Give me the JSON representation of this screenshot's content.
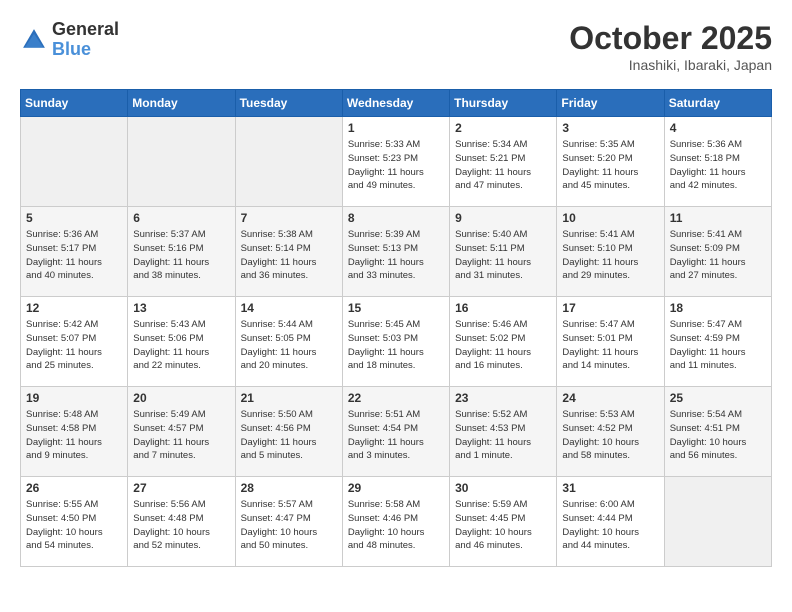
{
  "logo": {
    "line1": "General",
    "line2": "Blue"
  },
  "header": {
    "month": "October 2025",
    "location": "Inashiki, Ibaraki, Japan"
  },
  "weekdays": [
    "Sunday",
    "Monday",
    "Tuesday",
    "Wednesday",
    "Thursday",
    "Friday",
    "Saturday"
  ],
  "weeks": [
    [
      {
        "day": "",
        "info": ""
      },
      {
        "day": "",
        "info": ""
      },
      {
        "day": "",
        "info": ""
      },
      {
        "day": "1",
        "info": "Sunrise: 5:33 AM\nSunset: 5:23 PM\nDaylight: 11 hours\nand 49 minutes."
      },
      {
        "day": "2",
        "info": "Sunrise: 5:34 AM\nSunset: 5:21 PM\nDaylight: 11 hours\nand 47 minutes."
      },
      {
        "day": "3",
        "info": "Sunrise: 5:35 AM\nSunset: 5:20 PM\nDaylight: 11 hours\nand 45 minutes."
      },
      {
        "day": "4",
        "info": "Sunrise: 5:36 AM\nSunset: 5:18 PM\nDaylight: 11 hours\nand 42 minutes."
      }
    ],
    [
      {
        "day": "5",
        "info": "Sunrise: 5:36 AM\nSunset: 5:17 PM\nDaylight: 11 hours\nand 40 minutes."
      },
      {
        "day": "6",
        "info": "Sunrise: 5:37 AM\nSunset: 5:16 PM\nDaylight: 11 hours\nand 38 minutes."
      },
      {
        "day": "7",
        "info": "Sunrise: 5:38 AM\nSunset: 5:14 PM\nDaylight: 11 hours\nand 36 minutes."
      },
      {
        "day": "8",
        "info": "Sunrise: 5:39 AM\nSunset: 5:13 PM\nDaylight: 11 hours\nand 33 minutes."
      },
      {
        "day": "9",
        "info": "Sunrise: 5:40 AM\nSunset: 5:11 PM\nDaylight: 11 hours\nand 31 minutes."
      },
      {
        "day": "10",
        "info": "Sunrise: 5:41 AM\nSunset: 5:10 PM\nDaylight: 11 hours\nand 29 minutes."
      },
      {
        "day": "11",
        "info": "Sunrise: 5:41 AM\nSunset: 5:09 PM\nDaylight: 11 hours\nand 27 minutes."
      }
    ],
    [
      {
        "day": "12",
        "info": "Sunrise: 5:42 AM\nSunset: 5:07 PM\nDaylight: 11 hours\nand 25 minutes."
      },
      {
        "day": "13",
        "info": "Sunrise: 5:43 AM\nSunset: 5:06 PM\nDaylight: 11 hours\nand 22 minutes."
      },
      {
        "day": "14",
        "info": "Sunrise: 5:44 AM\nSunset: 5:05 PM\nDaylight: 11 hours\nand 20 minutes."
      },
      {
        "day": "15",
        "info": "Sunrise: 5:45 AM\nSunset: 5:03 PM\nDaylight: 11 hours\nand 18 minutes."
      },
      {
        "day": "16",
        "info": "Sunrise: 5:46 AM\nSunset: 5:02 PM\nDaylight: 11 hours\nand 16 minutes."
      },
      {
        "day": "17",
        "info": "Sunrise: 5:47 AM\nSunset: 5:01 PM\nDaylight: 11 hours\nand 14 minutes."
      },
      {
        "day": "18",
        "info": "Sunrise: 5:47 AM\nSunset: 4:59 PM\nDaylight: 11 hours\nand 11 minutes."
      }
    ],
    [
      {
        "day": "19",
        "info": "Sunrise: 5:48 AM\nSunset: 4:58 PM\nDaylight: 11 hours\nand 9 minutes."
      },
      {
        "day": "20",
        "info": "Sunrise: 5:49 AM\nSunset: 4:57 PM\nDaylight: 11 hours\nand 7 minutes."
      },
      {
        "day": "21",
        "info": "Sunrise: 5:50 AM\nSunset: 4:56 PM\nDaylight: 11 hours\nand 5 minutes."
      },
      {
        "day": "22",
        "info": "Sunrise: 5:51 AM\nSunset: 4:54 PM\nDaylight: 11 hours\nand 3 minutes."
      },
      {
        "day": "23",
        "info": "Sunrise: 5:52 AM\nSunset: 4:53 PM\nDaylight: 11 hours\nand 1 minute."
      },
      {
        "day": "24",
        "info": "Sunrise: 5:53 AM\nSunset: 4:52 PM\nDaylight: 10 hours\nand 58 minutes."
      },
      {
        "day": "25",
        "info": "Sunrise: 5:54 AM\nSunset: 4:51 PM\nDaylight: 10 hours\nand 56 minutes."
      }
    ],
    [
      {
        "day": "26",
        "info": "Sunrise: 5:55 AM\nSunset: 4:50 PM\nDaylight: 10 hours\nand 54 minutes."
      },
      {
        "day": "27",
        "info": "Sunrise: 5:56 AM\nSunset: 4:48 PM\nDaylight: 10 hours\nand 52 minutes."
      },
      {
        "day": "28",
        "info": "Sunrise: 5:57 AM\nSunset: 4:47 PM\nDaylight: 10 hours\nand 50 minutes."
      },
      {
        "day": "29",
        "info": "Sunrise: 5:58 AM\nSunset: 4:46 PM\nDaylight: 10 hours\nand 48 minutes."
      },
      {
        "day": "30",
        "info": "Sunrise: 5:59 AM\nSunset: 4:45 PM\nDaylight: 10 hours\nand 46 minutes."
      },
      {
        "day": "31",
        "info": "Sunrise: 6:00 AM\nSunset: 4:44 PM\nDaylight: 10 hours\nand 44 minutes."
      },
      {
        "day": "",
        "info": ""
      }
    ]
  ]
}
